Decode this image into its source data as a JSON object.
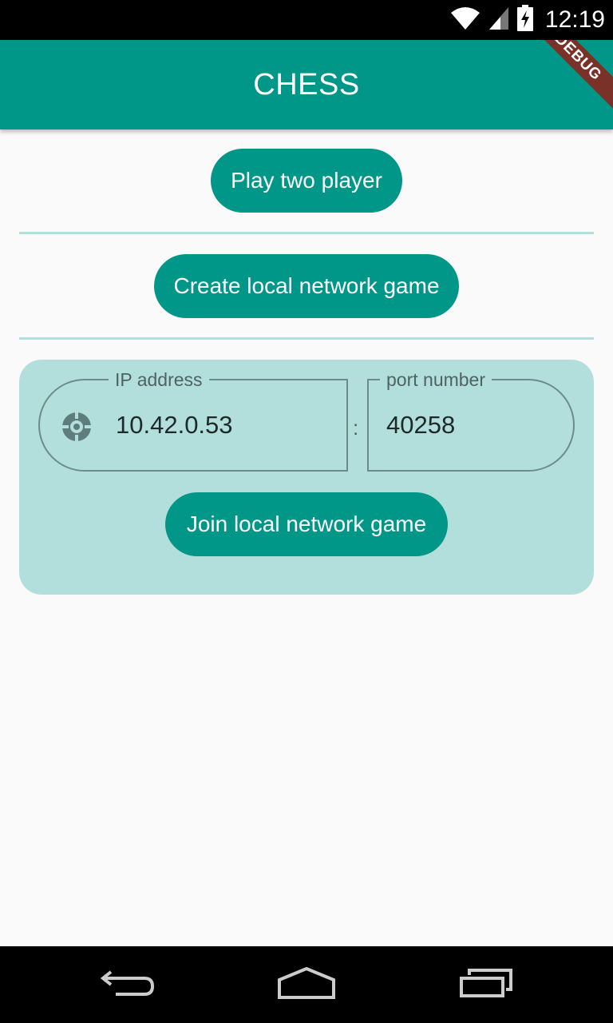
{
  "status_bar": {
    "time": "12:19",
    "icons": [
      "wifi-icon",
      "signal-icon",
      "battery-charging-icon"
    ]
  },
  "app_bar": {
    "title": "CHESS",
    "debug_banner": "DEBUG"
  },
  "buttons": {
    "play_two_player": "Play two player",
    "create_network_game": "Create local network game",
    "join_network_game": "Join local network game"
  },
  "network": {
    "ip": {
      "label": "IP address",
      "value": "10.42.0.53",
      "icon": "gear-icon"
    },
    "separator": ":",
    "port": {
      "label": "port number",
      "value": "40258"
    }
  },
  "nav_bar": {
    "icons": [
      "back-icon",
      "home-icon",
      "recents-icon"
    ]
  },
  "colors": {
    "primary": "#009688",
    "panel": "#b2dfdb",
    "background": "#fafafa"
  }
}
